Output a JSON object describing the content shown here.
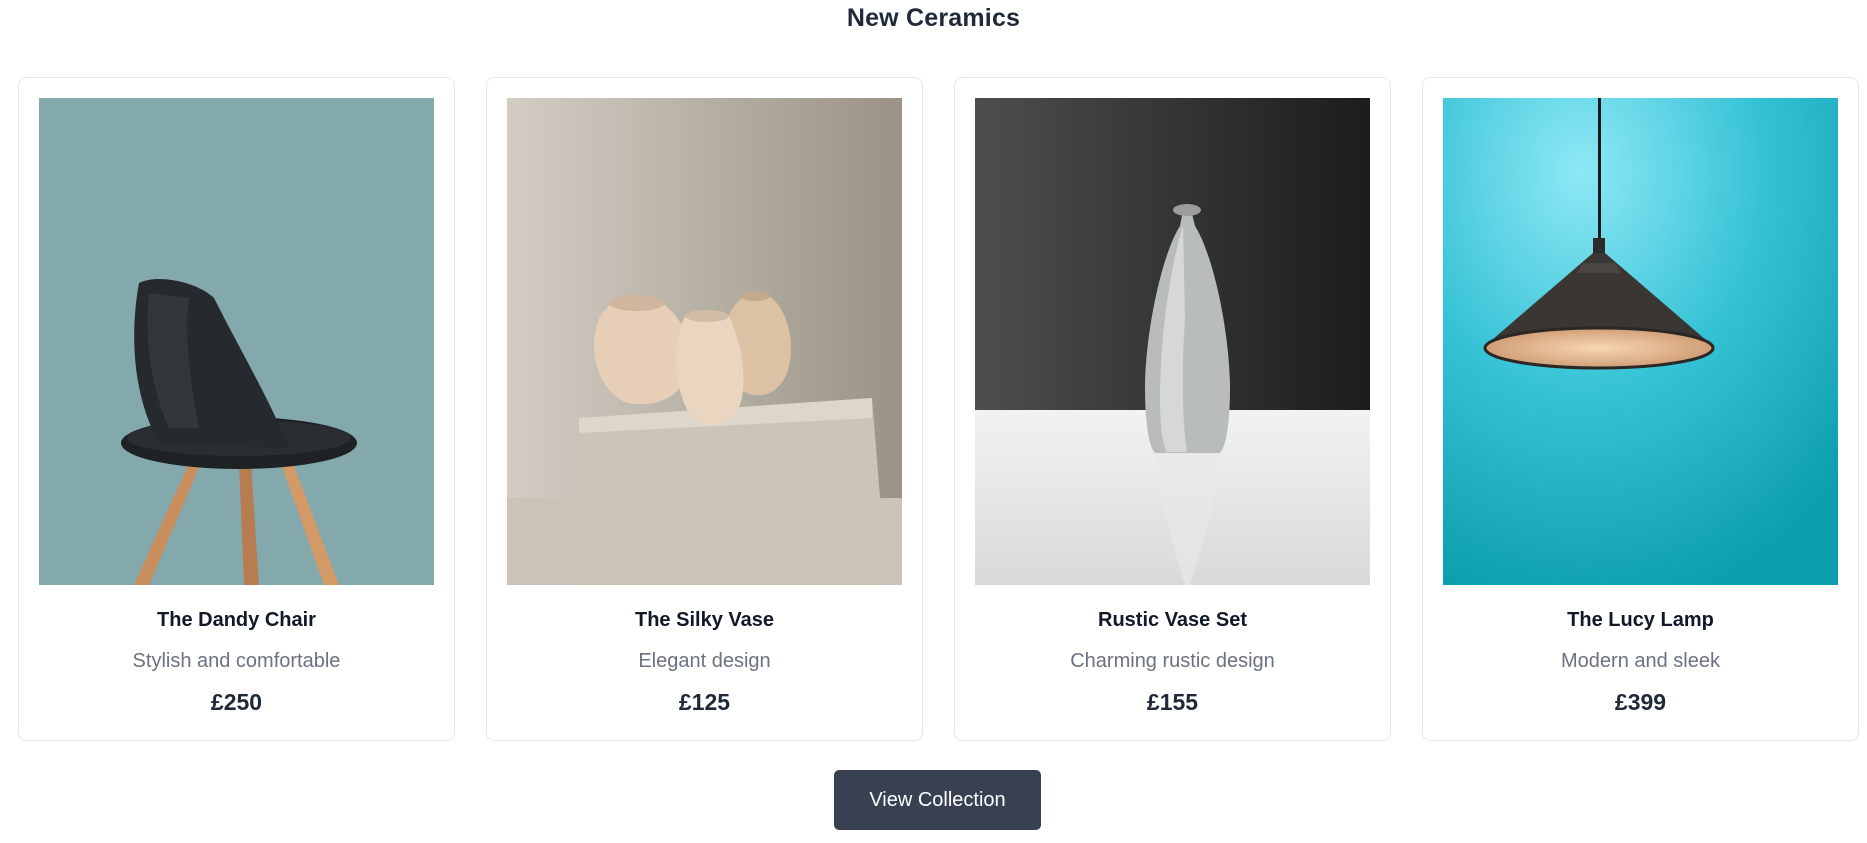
{
  "section": {
    "title": "New Ceramics"
  },
  "products": [
    {
      "name": "The Dandy Chair",
      "description": "Stylish and comfortable",
      "price": "£250",
      "image": "chair-photo",
      "bg_color": "#83a9ad"
    },
    {
      "name": "The Silky Vase",
      "description": "Elegant design",
      "price": "£125",
      "image": "vases-photo",
      "bg_color": "#b6ada0"
    },
    {
      "name": "Rustic Vase Set",
      "description": "Charming rustic design",
      "price": "£155",
      "image": "bottle-vase-photo",
      "bg_color": "#2f302f"
    },
    {
      "name": "The Lucy Lamp",
      "description": "Modern and sleek",
      "price": "£399",
      "image": "pendant-lamp-photo",
      "bg_color": "#1fb3c4"
    }
  ],
  "cta": {
    "label": "View Collection"
  },
  "colors": {
    "button": "#374151",
    "title": "#1f2937",
    "muted": "#6b7280",
    "card_border": "#e5e7eb"
  }
}
